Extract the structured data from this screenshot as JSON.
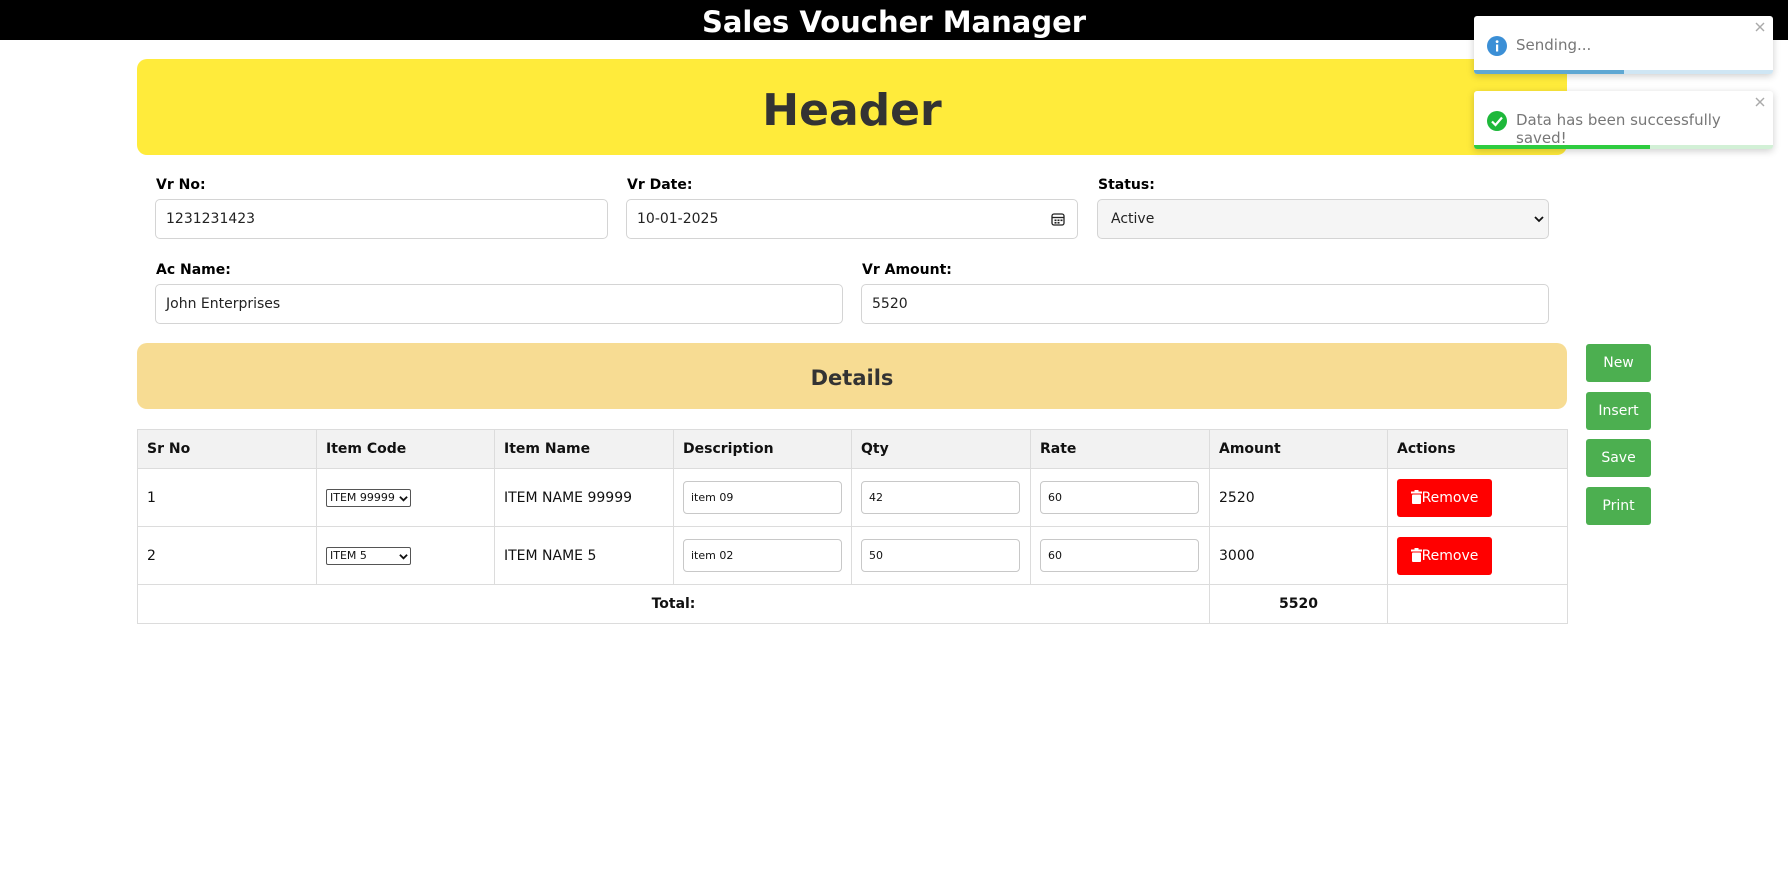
{
  "app": {
    "title": "Sales Voucher Manager"
  },
  "header": {
    "title": "Header"
  },
  "form": {
    "vr_no": {
      "label": "Vr No:",
      "value": "1231231423"
    },
    "vr_date": {
      "label": "Vr Date:",
      "value": "10-01-2025"
    },
    "status": {
      "label": "Status:",
      "value": "Active"
    },
    "ac_name": {
      "label": "Ac Name:",
      "value": "John Enterprises"
    },
    "vr_amount": {
      "label": "Vr Amount:",
      "value": "5520"
    }
  },
  "details": {
    "title": "Details",
    "columns": [
      "Sr No",
      "Item Code",
      "Item Name",
      "Description",
      "Qty",
      "Rate",
      "Amount",
      "Actions"
    ],
    "rows": [
      {
        "sr": "1",
        "item_code": "ITEM 99999",
        "item_name": "ITEM NAME 99999",
        "description": "item 09",
        "qty": "42",
        "rate": "60",
        "amount": "2520",
        "action": "Remove"
      },
      {
        "sr": "2",
        "item_code": "ITEM 5",
        "item_name": "ITEM NAME 5",
        "description": "item 02",
        "qty": "50",
        "rate": "60",
        "amount": "3000",
        "action": "Remove"
      }
    ],
    "total_label": "Total:",
    "total_value": "5520"
  },
  "actions": {
    "new": "New",
    "insert": "Insert",
    "save": "Save",
    "print": "Print"
  },
  "toasts": [
    {
      "message": "Sending...",
      "type": "info",
      "progress": 0.5,
      "icon": "info-circle-icon"
    },
    {
      "message": "Data has been successfully saved!",
      "type": "success",
      "progress": 0.59,
      "icon": "check-circle-icon"
    }
  ],
  "colors": {
    "topbar": "#000000",
    "header": "#ffeb3b",
    "details": "#f7dc93",
    "button_green": "#4caf50",
    "button_red": "#ff0000",
    "toast_info": "#5fa8d3",
    "toast_success": "#2ecc40"
  }
}
